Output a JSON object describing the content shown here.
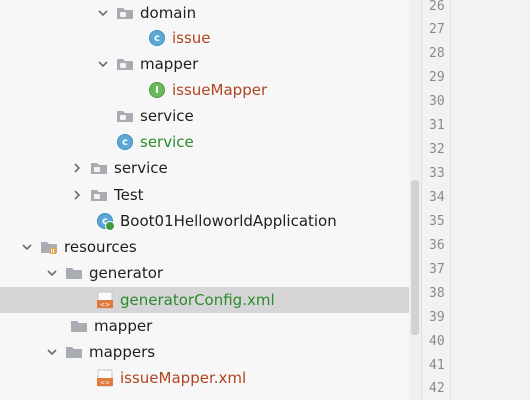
{
  "tree": {
    "domain": "domain",
    "issue": "issue",
    "mapper_pkg": "mapper",
    "issueMapper": "issueMapper",
    "service_pkg": "service",
    "service_class": "service",
    "service_folder": "service",
    "test": "Test",
    "app": "Boot01HelloworldApplication",
    "resources": "resources",
    "generator": "generator",
    "generatorConfig": "generatorConfig.xml",
    "mapper_res": "mapper",
    "mappers": "mappers",
    "issueMapperXml": "issueMapper.xml"
  },
  "gutter": {
    "lines": [
      "26",
      "27",
      "28",
      "29",
      "30",
      "31",
      "32",
      "33",
      "34",
      "35",
      "36",
      "37",
      "38",
      "39",
      "40",
      "41",
      "42"
    ]
  },
  "colors": {
    "class_icon": "#5ba8d6",
    "interface_icon": "#69b95a",
    "selected_row": "#d6d6d8",
    "xml_icon": "#e07a3d"
  }
}
